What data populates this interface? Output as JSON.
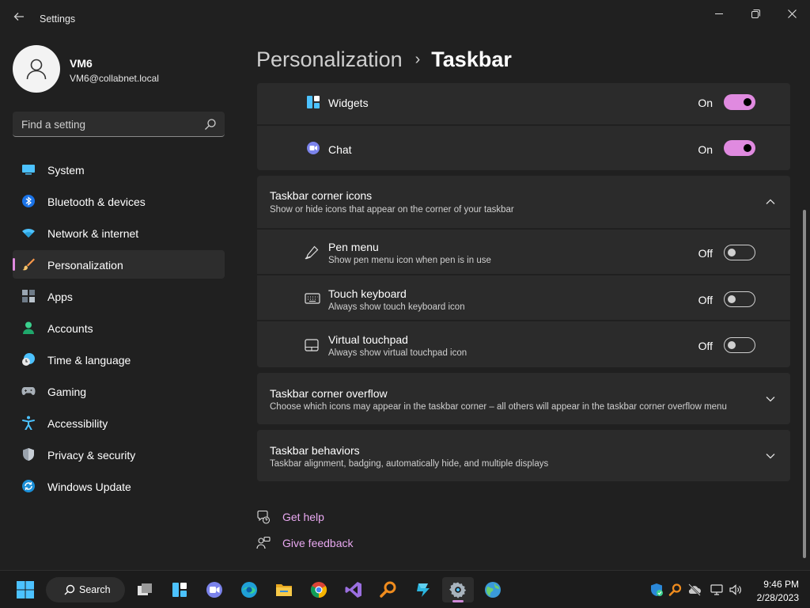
{
  "window": {
    "title": "Settings"
  },
  "user": {
    "name": "VM6",
    "email": "VM6@collabnet.local"
  },
  "search": {
    "placeholder": "Find a setting"
  },
  "sidebar": {
    "items": [
      {
        "label": "System",
        "icon": "system-icon"
      },
      {
        "label": "Bluetooth & devices",
        "icon": "bluetooth-icon"
      },
      {
        "label": "Network & internet",
        "icon": "wifi-icon"
      },
      {
        "label": "Personalization",
        "icon": "brush-icon",
        "active": true
      },
      {
        "label": "Apps",
        "icon": "apps-icon"
      },
      {
        "label": "Accounts",
        "icon": "accounts-icon"
      },
      {
        "label": "Time & language",
        "icon": "clock-globe-icon"
      },
      {
        "label": "Gaming",
        "icon": "gamepad-icon"
      },
      {
        "label": "Accessibility",
        "icon": "accessibility-icon"
      },
      {
        "label": "Privacy & security",
        "icon": "shield-icon"
      },
      {
        "label": "Windows Update",
        "icon": "update-icon"
      }
    ]
  },
  "breadcrumb": {
    "parent": "Personalization",
    "separator": "›",
    "current": "Taskbar"
  },
  "taskbar_items": {
    "widgets": {
      "label": "Widgets",
      "state": "On",
      "on": true,
      "icon": "widgets-icon"
    },
    "chat": {
      "label": "Chat",
      "state": "On",
      "on": true,
      "icon": "chat-icon"
    }
  },
  "corner_icons": {
    "title": "Taskbar corner icons",
    "subtitle": "Show or hide icons that appear on the corner of your taskbar",
    "expanded": true,
    "items": [
      {
        "label": "Pen menu",
        "desc": "Show pen menu icon when pen is in use",
        "state": "Off",
        "on": false,
        "icon": "pen-icon"
      },
      {
        "label": "Touch keyboard",
        "desc": "Always show touch keyboard icon",
        "state": "Off",
        "on": false,
        "icon": "keyboard-icon"
      },
      {
        "label": "Virtual touchpad",
        "desc": "Always show virtual touchpad icon",
        "state": "Off",
        "on": false,
        "icon": "touchpad-icon"
      }
    ]
  },
  "corner_overflow": {
    "title": "Taskbar corner overflow",
    "subtitle": "Choose which icons may appear in the taskbar corner – all others will appear in the taskbar corner overflow menu"
  },
  "behaviors": {
    "title": "Taskbar behaviors",
    "subtitle": "Taskbar alignment, badging, automatically hide, and multiple displays"
  },
  "footer": {
    "help": "Get help",
    "feedback": "Give feedback"
  },
  "os_taskbar": {
    "search_label": "Search",
    "apps": [
      "task-view-icon",
      "widgets-icon",
      "chat-icon",
      "edge-icon",
      "file-explorer-icon",
      "chrome-icon",
      "visual-studio-icon",
      "search-tool-icon",
      "azure-data-studio-icon",
      "settings-icon",
      "globe-icon"
    ],
    "active_app": "settings-icon",
    "clock_time": "9:46 PM",
    "clock_date": "2/28/2023"
  },
  "colors": {
    "accent": "#e08ae0",
    "link": "#e8a8f0",
    "background": "#202020",
    "card": "#2b2b2b"
  }
}
